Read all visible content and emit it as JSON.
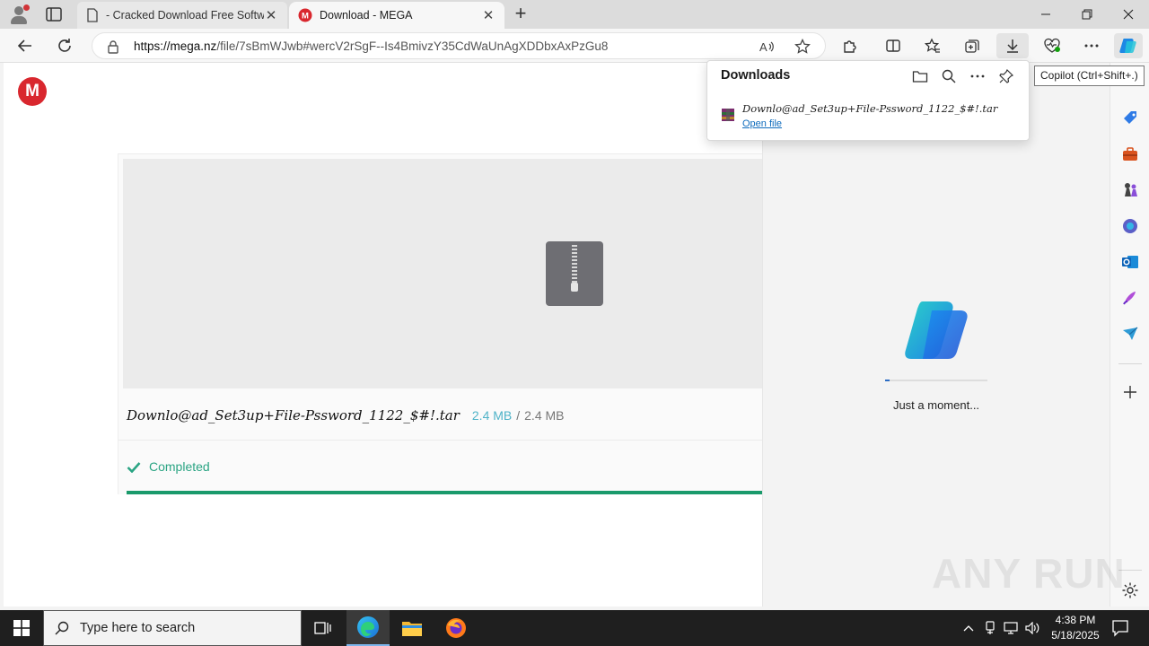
{
  "browser": {
    "tabs": [
      {
        "title": "- Cracked Download Free Softwa",
        "active": false
      },
      {
        "title": "Download - MEGA",
        "active": true
      }
    ],
    "url_host": "https://mega.nz",
    "url_path": "/file/7sBmWJwb#wercV2rSgF--Is4BmivzY35CdWaUnAgXDDbxAxPzGu8"
  },
  "downloads_flyout": {
    "title": "Downloads",
    "items": [
      {
        "name": "Downlo@ad_Set3up+File-Pssword_1122_$#!.tar",
        "action": "Open file"
      }
    ]
  },
  "tooltip": "Copilot (Ctrl+Shift+.)",
  "page": {
    "logo_letter": "M",
    "file": {
      "name": "Downlo@ad_Set3up+File-Pssword_1122_$#!.tar",
      "size_downloaded": "2.4 MB",
      "size_separator": "/",
      "size_total": "2.4 MB",
      "status": "Completed",
      "progress": 1.0
    },
    "colors": {
      "brand": "#d9272e",
      "completed": "#1a9a6b"
    }
  },
  "copilot": {
    "message": "Just a moment...",
    "loading_progress": 0.04
  },
  "taskbar": {
    "search_placeholder": "Type here to search",
    "time": "4:38 PM",
    "date": "5/18/2025"
  },
  "watermark": "ANY RUN"
}
